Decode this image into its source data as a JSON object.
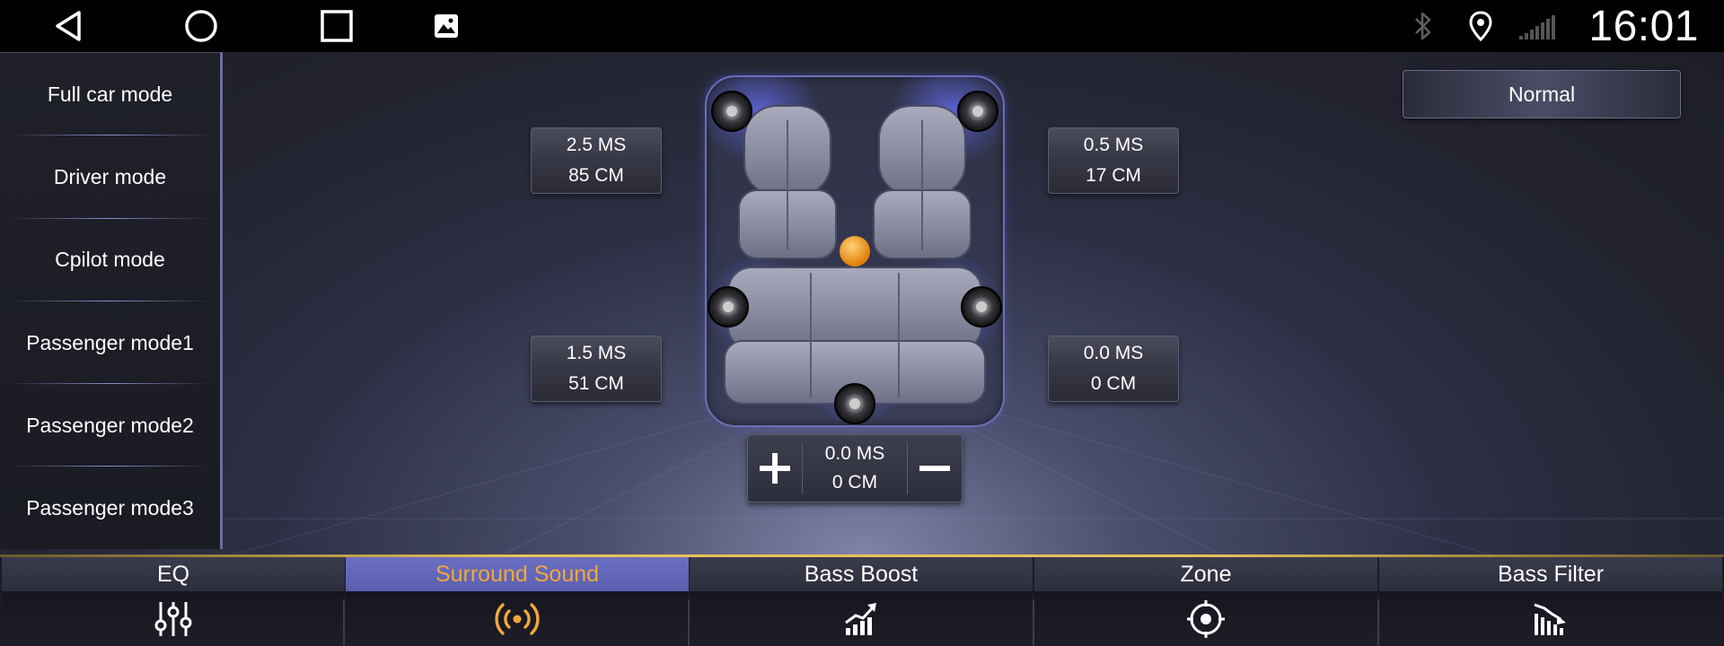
{
  "status_bar": {
    "nav": [
      "back-icon",
      "home-icon",
      "recents-icon",
      "gallery-icon"
    ],
    "icons": [
      "bluetooth-icon",
      "location-icon",
      "signal-icon"
    ],
    "time": "16:01"
  },
  "sidebar": {
    "items": [
      {
        "label": "Full car mode"
      },
      {
        "label": "Driver mode"
      },
      {
        "label": "Cpilot mode"
      },
      {
        "label": "Passenger mode1"
      },
      {
        "label": "Passenger mode2"
      },
      {
        "label": "Passenger mode3"
      }
    ]
  },
  "preset": {
    "label": "Normal"
  },
  "delays": {
    "front_left": {
      "ms": "2.5 MS",
      "cm": "85 CM"
    },
    "front_right": {
      "ms": "0.5 MS",
      "cm": "17 CM"
    },
    "rear_left": {
      "ms": "1.5 MS",
      "cm": "51 CM"
    },
    "rear_right": {
      "ms": "0.0 MS",
      "cm": "0 CM"
    },
    "center": {
      "ms": "0.0 MS",
      "cm": "0 CM"
    }
  },
  "tabs": [
    {
      "label": "EQ",
      "icon": "equalizer-icon"
    },
    {
      "label": "Surround Sound",
      "icon": "surround-icon",
      "active": true
    },
    {
      "label": "Bass Boost",
      "icon": "bass-boost-icon"
    },
    {
      "label": "Zone",
      "icon": "zone-icon"
    },
    {
      "label": "Bass Filter",
      "icon": "bass-filter-icon"
    }
  ],
  "colors": {
    "active_tab_bg": "#6a6fc2",
    "active_tab_text": "#f2a83a",
    "accent_line": "#e6c25a",
    "speaker_glow": "#5a64d8",
    "listener_dot": "#f59a12"
  }
}
